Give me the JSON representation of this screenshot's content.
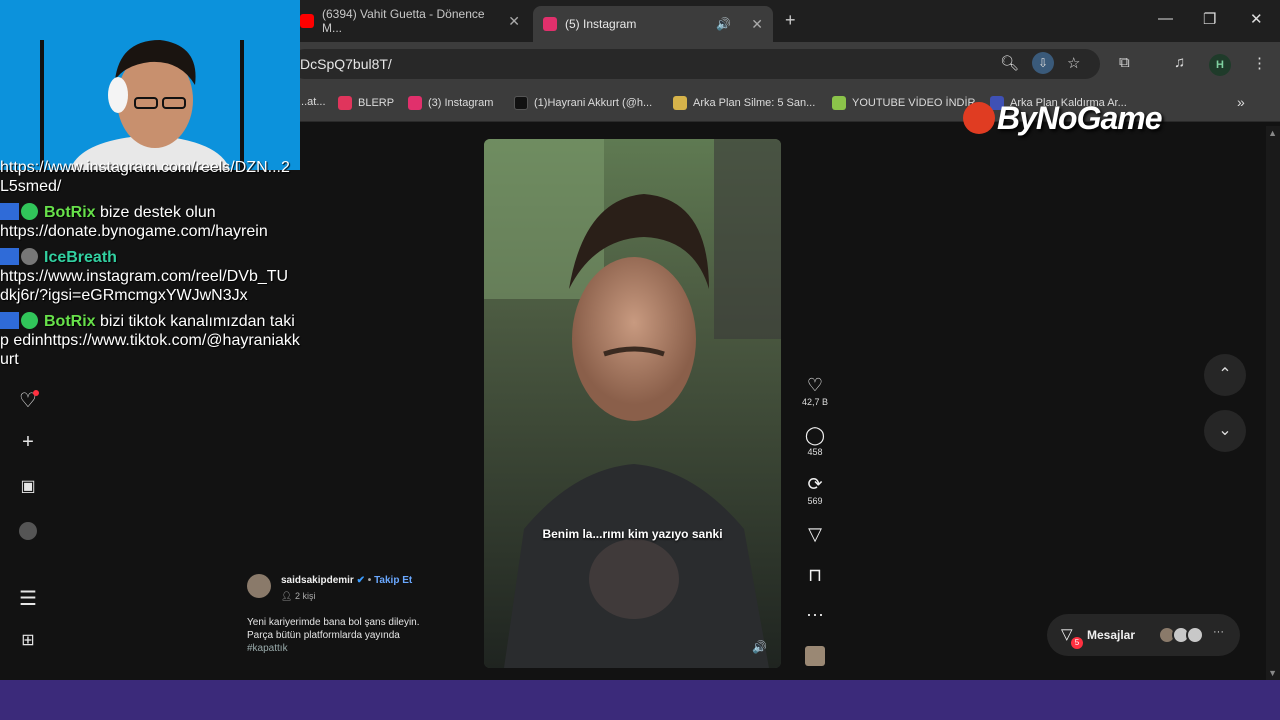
{
  "browser": {
    "tabs": [
      {
        "title": "(6394) Vahit Guetta - Dönence M...",
        "favicon_color": "#ff0000",
        "active": false
      },
      {
        "title": "(5) Instagram",
        "favicon_color": "#e1306c",
        "active": true
      }
    ],
    "url": "DcSpQ7bul8T/",
    "profile_initial": "H",
    "bookmarks": [
      {
        "label": "...at...",
        "fav_color": "#888888"
      },
      {
        "label": "BLERP",
        "fav_color": "#e0355c"
      },
      {
        "label": "(3) Instagram",
        "fav_color": "#e1306c"
      },
      {
        "label": "(1)Hayrani Akkurt (@h...",
        "fav_color": "#111111"
      },
      {
        "label": "Arka Plan Silme: 5 San...",
        "fav_color": "#d6b34a"
      },
      {
        "label": "YOUTUBE VİDEO İNDİR",
        "fav_color": "#8bc34a"
      },
      {
        "label": "Arka Plan Kaldırma Ar...",
        "fav_color": "#3f51b5"
      }
    ]
  },
  "reel": {
    "caption": "Benim la...rımı kim yazıyo sanki",
    "likes": "42,7 B",
    "comments": "458",
    "reposts": "569",
    "author": "saidsakipdemir",
    "follow_label": "Takip Et",
    "followers_label": "2 kişi",
    "description_lines": [
      "Yeni kariyerimde bana bol şans dileyin.",
      "Parça bütün platformlarda yayında"
    ],
    "hashtag": "#kapattık"
  },
  "messages": {
    "label": "Mesajlar",
    "badge": "5"
  },
  "chat": [
    {
      "text": "https://www.instagram.com/reels/DZN...2L5smed/"
    },
    {
      "user": "BotRix",
      "text": "bize destek olun https://donate.bynogame.com/hayrein"
    },
    {
      "user": "IceBreath",
      "text": "https://www.instagram.com/reel/DVb_TUdkj6r/?igsi=eGRmcmgxYWJwN3Jx"
    },
    {
      "user": "BotRix",
      "text": "bizi tiktok kanalımızdan takip edinhttps://www.tiktok.com/@hayraniakkurt"
    }
  ],
  "watermark": "ByNoGame"
}
